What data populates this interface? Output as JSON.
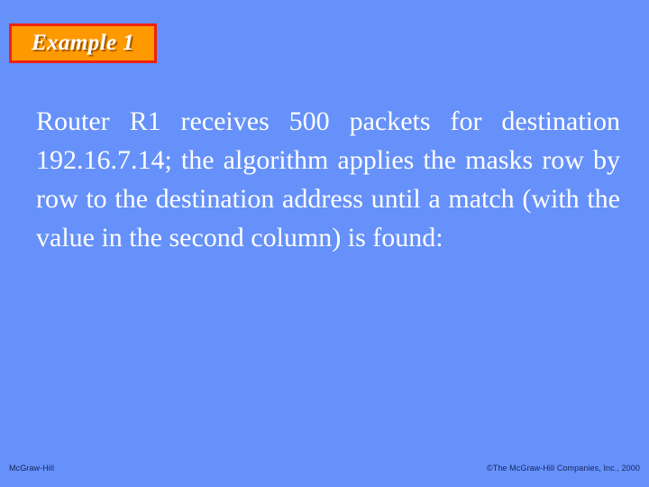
{
  "slide": {
    "background_color": "#6691fa",
    "title": {
      "label": "Example 1",
      "box_fill_color": "#ff9900",
      "box_border_color": "#ee2211",
      "text_color": "#ffffff"
    },
    "body": {
      "text_color": "#ffffff",
      "lines": [
        "Router R1 receives 500 packets for",
        "destination 192.16.7.14; the algorithm",
        "applies the masks row by row to the",
        "destination address until a match (with the",
        "value in the second column) is found:"
      ],
      "paragraph": "Router R1 receives 500 packets for destination 192.16.7.14; the algorithm applies the masks row by row to the destination address until a match (with the value in the second column) is found:"
    },
    "footer": {
      "left": "McGraw-Hill",
      "right": "©The McGraw-Hill Companies, Inc., 2000",
      "text_color": "#17255e"
    }
  }
}
